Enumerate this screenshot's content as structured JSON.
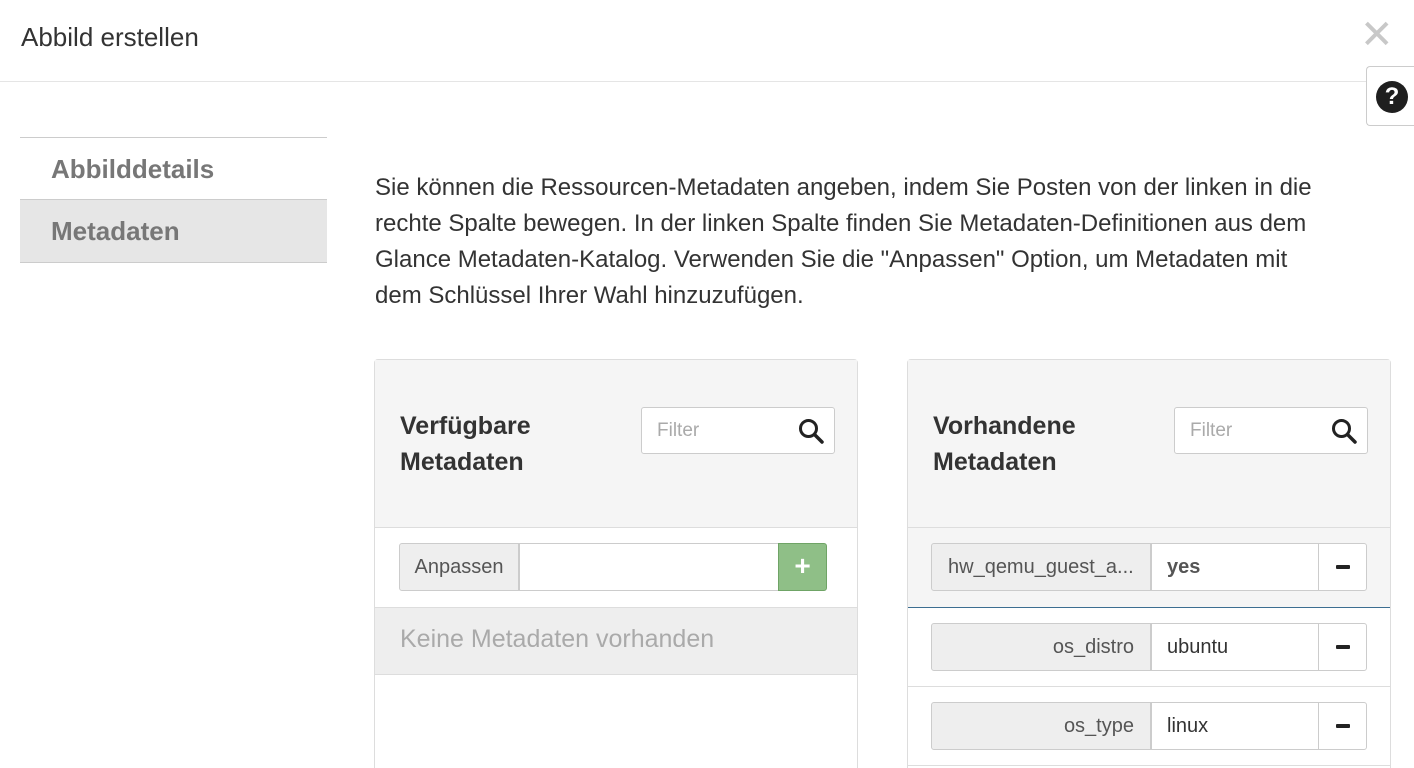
{
  "modal": {
    "title": "Abbild erstellen",
    "close_icon": "close-icon",
    "help_icon": "question-circle-icon",
    "help_glyph": "?"
  },
  "wizard_nav": {
    "items": [
      {
        "label": "Abbilddetails",
        "active": false
      },
      {
        "label": "Metadaten",
        "active": true
      }
    ]
  },
  "help_text": "Sie können die Ressourcen-Metadaten angeben, indem Sie Posten von der linken in die rechte Spalte bewegen. In der linken Spalte finden Sie Metadaten-Definitionen aus dem Glance Metadaten-Katalog. Verwenden Sie die \"Anpassen\" Option, um Metadaten mit dem Schlüssel Ihrer Wahl hinzuzufügen.",
  "available": {
    "title": "Verfügbare Metadaten",
    "filter_placeholder": "Filter",
    "custom_label": "Anpassen",
    "custom_value": "",
    "add_glyph": "+",
    "empty_text": "Keine Metadaten vorhanden"
  },
  "existing": {
    "title": "Vorhandene Metadaten",
    "filter_placeholder": "Filter",
    "items": [
      {
        "key": "hw_qemu_guest_agent",
        "key_display": "hw_qemu_guest_a...",
        "value": "yes"
      },
      {
        "key": "os_distro",
        "key_display": "os_distro",
        "value": "ubuntu"
      },
      {
        "key": "os_type",
        "key_display": "os_type",
        "value": "linux"
      }
    ]
  }
}
